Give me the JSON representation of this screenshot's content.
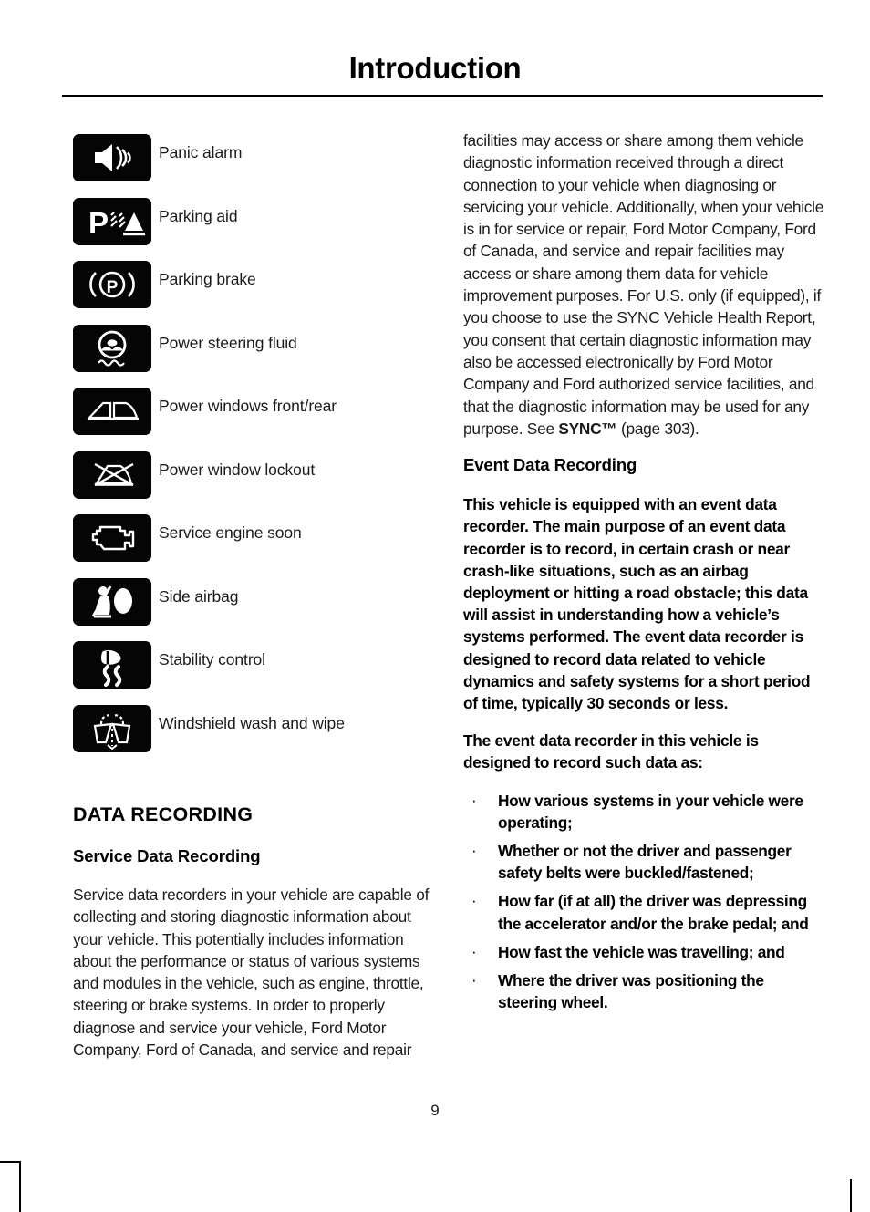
{
  "document": {
    "title": "Introduction",
    "page_number": "9"
  },
  "symbols": [
    {
      "icon": "panic-alarm-icon",
      "label": "Panic alarm"
    },
    {
      "icon": "parking-aid-icon",
      "label": "Parking aid"
    },
    {
      "icon": "parking-brake-icon",
      "label": "Parking brake"
    },
    {
      "icon": "power-steering-fluid-icon",
      "label": "Power steering fluid"
    },
    {
      "icon": "power-windows-front-rear-icon",
      "label": "Power windows front/rear"
    },
    {
      "icon": "power-window-lockout-icon",
      "label": "Power window lockout"
    },
    {
      "icon": "service-engine-soon-icon",
      "label": "Service engine soon"
    },
    {
      "icon": "side-airbag-icon",
      "label": "Side airbag"
    },
    {
      "icon": "stability-control-icon",
      "label": "Stability control"
    },
    {
      "icon": "windshield-wash-wipe-icon",
      "label": "Windshield wash and wipe"
    }
  ],
  "left_column": {
    "section_heading": "DATA RECORDING",
    "sub_heading": "Service Data Recording",
    "paragraph": "Service data recorders in your vehicle are capable of collecting and storing diagnostic information about your vehicle. This potentially includes information about the performance or status of various systems and modules in the vehicle, such as engine, throttle, steering or brake systems. In order to properly diagnose and service your vehicle, Ford Motor Company, Ford of Canada, and service and repair"
  },
  "right_column": {
    "continued_paragraph_part1": "facilities may access or share among them vehicle diagnostic information received through a direct connection to your vehicle when diagnosing or servicing your vehicle. Additionally, when your vehicle is in for service or repair, Ford Motor Company, Ford of Canada, and service and repair facilities may access or share among them data for vehicle improvement purposes. For U.S. only (if equipped), if you choose to use the SYNC Vehicle Health Report, you consent that certain diagnostic information may also be accessed electronically by Ford Motor Company and Ford authorized service facilities, and that the diagnostic information may be used for any purpose.  See ",
    "cross_reference_bold": "SYNC™",
    "continued_paragraph_part2": " (page 303).",
    "sub_heading": "Event Data Recording",
    "paragraph_1": "This vehicle is equipped with an event data recorder. The main purpose of an event data recorder is to record, in certain crash or near crash-like situations, such as an airbag deployment or hitting a road obstacle; this data will assist in understanding how a vehicle’s systems performed. The event data recorder is designed to record data related to vehicle dynamics and safety systems for a short period of time, typically 30 seconds or less.",
    "paragraph_2": "The event data recorder in this vehicle is designed to record such data as:",
    "bullet_marker": "·",
    "bullets": [
      "How various systems in your vehicle were operating;",
      "Whether or not the driver and passenger safety belts were buckled/fastened;",
      "How far (if at all) the driver was depressing the accelerator and/or the brake pedal; and",
      "How fast the vehicle was travelling; and",
      "Where the driver was positioning the steering wheel."
    ]
  },
  "colors": {
    "icon_background": "#050505",
    "icon_foreground": "#ffffff",
    "text": "#1b1b1b",
    "page_background": "#ffffff"
  }
}
